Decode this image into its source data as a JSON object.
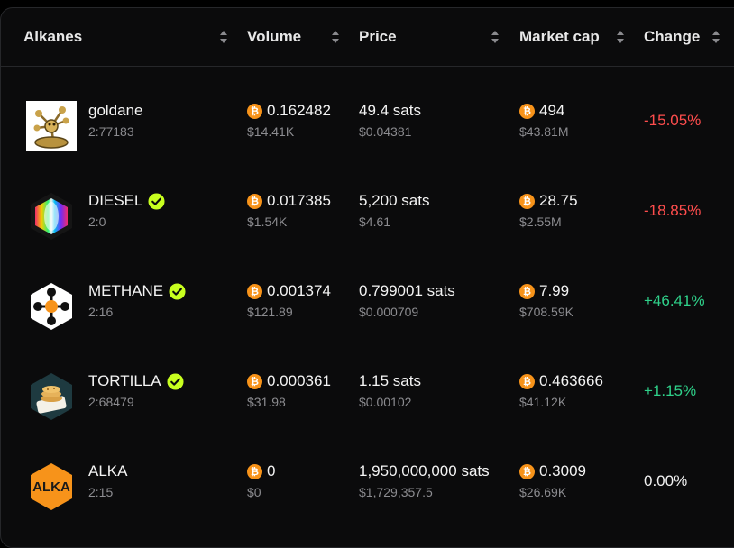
{
  "colors": {
    "negative": "#ff4d4d",
    "positive": "#2fd18a",
    "neutral": "#f2f2f2",
    "verified": "#c8ff1f",
    "btc": "#f7931a"
  },
  "header": {
    "alkanes": "Alkanes",
    "volume": "Volume",
    "price": "Price",
    "market_cap": "Market cap",
    "change": "Change"
  },
  "rows": [
    {
      "name": "goldane",
      "id": "2:77183",
      "verified": false,
      "logo": "goldane-logo",
      "volume_btc": "0.162482",
      "volume_usd": "$14.41K",
      "price_sats": "49.4 sats",
      "price_usd": "$0.04381",
      "mcap_btc": "494",
      "mcap_usd": "$43.81M",
      "change": "-15.05%",
      "trend": "negative"
    },
    {
      "name": "DIESEL",
      "id": "2:0",
      "verified": true,
      "logo": "diesel-logo",
      "volume_btc": "0.017385",
      "volume_usd": "$1.54K",
      "price_sats": "5,200 sats",
      "price_usd": "$4.61",
      "mcap_btc": "28.75",
      "mcap_usd": "$2.55M",
      "change": "-18.85%",
      "trend": "negative"
    },
    {
      "name": "METHANE",
      "id": "2:16",
      "verified": true,
      "logo": "methane-logo",
      "volume_btc": "0.001374",
      "volume_usd": "$121.89",
      "price_sats": "0.799001 sats",
      "price_usd": "$0.000709",
      "mcap_btc": "7.99",
      "mcap_usd": "$708.59K",
      "change": "+46.41%",
      "trend": "positive"
    },
    {
      "name": "TORTILLA",
      "id": "2:68479",
      "verified": true,
      "logo": "tortilla-logo",
      "volume_btc": "0.000361",
      "volume_usd": "$31.98",
      "price_sats": "1.15 sats",
      "price_usd": "$0.00102",
      "mcap_btc": "0.463666",
      "mcap_usd": "$41.12K",
      "change": "+1.15%",
      "trend": "positive"
    },
    {
      "name": "ALKA",
      "id": "2:15",
      "verified": false,
      "logo": "alka-logo",
      "logo_text": "ALKA",
      "volume_btc": "0",
      "volume_usd": "$0",
      "price_sats": "1,950,000,000 sats",
      "price_usd": "$1,729,357.5",
      "mcap_btc": "0.3009",
      "mcap_usd": "$26.69K",
      "change": "0.00%",
      "trend": "neutral"
    }
  ]
}
